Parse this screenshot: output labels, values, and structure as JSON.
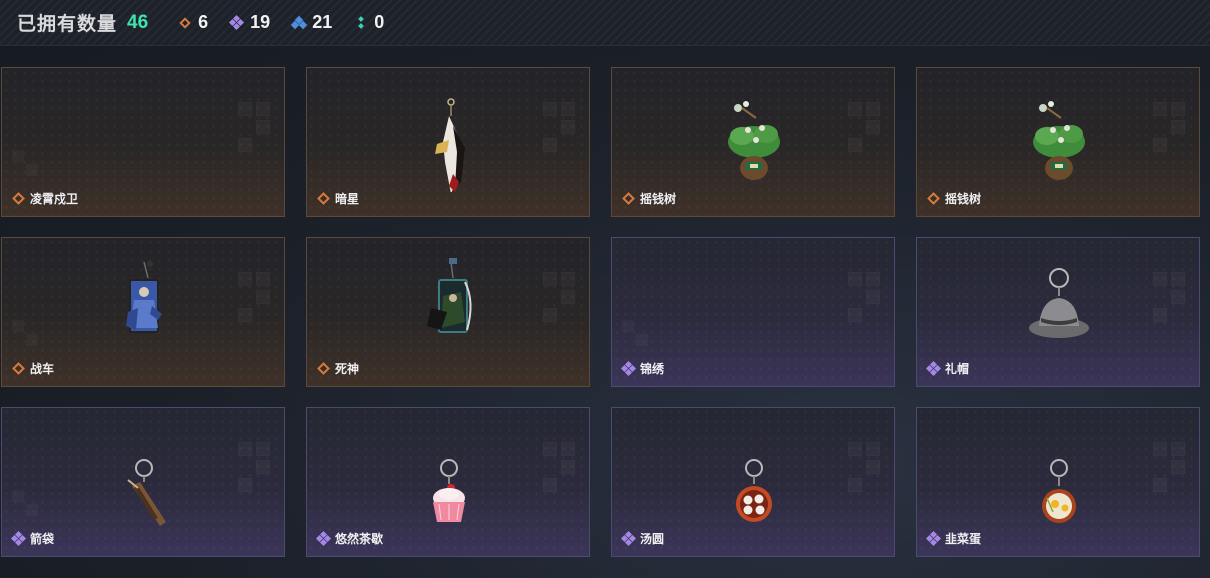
{
  "header": {
    "owned_label": "已拥有数量",
    "owned_count": "46",
    "rarity_counts": [
      {
        "rarity": "orange",
        "value": "6"
      },
      {
        "rarity": "purple",
        "value": "19"
      },
      {
        "rarity": "blue",
        "value": "21"
      },
      {
        "rarity": "teal",
        "value": "0"
      }
    ]
  },
  "colors": {
    "owned_count": "#3fe3b0",
    "rarity_orange": "#d77a3e",
    "rarity_purple": "#a487e6",
    "rarity_blue": "#4d8ee0",
    "rarity_teal": "#3fd2b0"
  },
  "items": [
    {
      "name": "凌霄戍卫",
      "rarity": "orange",
      "icon": "empty"
    },
    {
      "name": "暗星",
      "rarity": "orange",
      "icon": "feather-blade-charm-icon"
    },
    {
      "name": "摇钱树",
      "rarity": "orange",
      "icon": "money-tree-charm-icon"
    },
    {
      "name": "摇钱树",
      "rarity": "orange",
      "icon": "money-tree-charm-icon"
    },
    {
      "name": "战车",
      "rarity": "orange",
      "icon": "chariot-card-charm-icon"
    },
    {
      "name": "死神",
      "rarity": "orange",
      "icon": "death-card-charm-icon"
    },
    {
      "name": "锦绣",
      "rarity": "purple",
      "icon": "empty"
    },
    {
      "name": "礼帽",
      "rarity": "purple",
      "icon": "hat-charm-icon"
    },
    {
      "name": "箭袋",
      "rarity": "purple",
      "icon": "quiver-charm-icon"
    },
    {
      "name": "悠然茶歇",
      "rarity": "purple",
      "icon": "cupcake-charm-icon"
    },
    {
      "name": "汤圆",
      "rarity": "purple",
      "icon": "tangyuan-charm-icon"
    },
    {
      "name": "韭菜蛋",
      "rarity": "purple",
      "icon": "fried-egg-pan-charm-icon"
    }
  ]
}
